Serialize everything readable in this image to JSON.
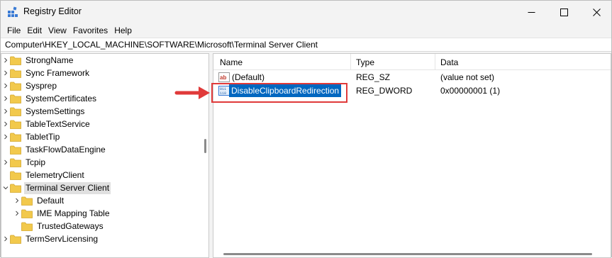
{
  "window": {
    "title": "Registry Editor",
    "controls": [
      "minimize",
      "maximize",
      "close"
    ]
  },
  "menu": [
    "File",
    "Edit",
    "View",
    "Favorites",
    "Help"
  ],
  "address": "Computer\\HKEY_LOCAL_MACHINE\\SOFTWARE\\Microsoft\\Terminal Server Client",
  "tree": [
    {
      "label": "StrongName",
      "expandable": true,
      "indent": 0
    },
    {
      "label": "Sync Framework",
      "expandable": true,
      "indent": 0
    },
    {
      "label": "Sysprep",
      "expandable": true,
      "indent": 0
    },
    {
      "label": "SystemCertificates",
      "expandable": true,
      "indent": 0
    },
    {
      "label": "SystemSettings",
      "expandable": true,
      "indent": 0
    },
    {
      "label": "TableTextService",
      "expandable": true,
      "indent": 0
    },
    {
      "label": "TabletTip",
      "expandable": true,
      "indent": 0
    },
    {
      "label": "TaskFlowDataEngine",
      "expandable": false,
      "indent": 0
    },
    {
      "label": "Tcpip",
      "expandable": true,
      "indent": 0
    },
    {
      "label": "TelemetryClient",
      "expandable": false,
      "indent": 0
    },
    {
      "label": "Terminal Server Client",
      "expandable": true,
      "expanded": true,
      "selected": true,
      "indent": 0
    },
    {
      "label": "Default",
      "expandable": true,
      "indent": 1
    },
    {
      "label": "IME Mapping Table",
      "expandable": true,
      "indent": 1
    },
    {
      "label": "TrustedGateways",
      "expandable": false,
      "indent": 1
    },
    {
      "label": "TermServLicensing",
      "expandable": true,
      "indent": 0
    }
  ],
  "list": {
    "headers": {
      "name": "Name",
      "type": "Type",
      "data": "Data"
    },
    "rows": [
      {
        "name": "(Default)",
        "type": "REG_SZ",
        "data": "(value not set)",
        "icon": "string-value-icon",
        "selected": false
      },
      {
        "name": "DisableClipboardRedirection",
        "type": "REG_DWORD",
        "data": "0x00000001 (1)",
        "icon": "dword-value-icon",
        "selected": true
      }
    ]
  },
  "annotation": {
    "arrow_color": "#e03a3a",
    "box_color": "#e03a3a"
  },
  "colors": {
    "selection": "#0067c0",
    "folder": "#f2c94c",
    "tree_selected": "#e0e0e0"
  }
}
